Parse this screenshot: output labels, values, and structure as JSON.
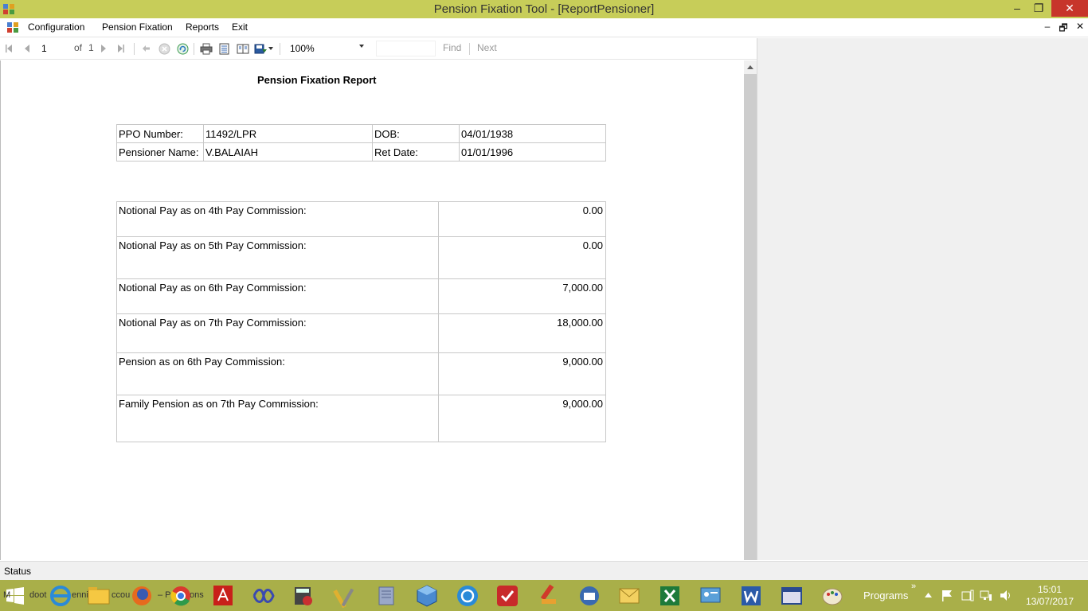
{
  "window": {
    "title": "Pension Fixation Tool - [ReportPensioner]",
    "controls": {
      "minimize": "–",
      "maximize": "❐",
      "close": "✕"
    }
  },
  "menu": {
    "items": [
      "Configuration",
      "Pension Fixation",
      "Reports",
      "Exit"
    ],
    "mdi_controls": {
      "minimize": "–",
      "restore": "🗗",
      "close": "✕"
    }
  },
  "toolbar": {
    "current_page": "1",
    "of_label": "of",
    "total_pages": "1",
    "zoom": "100%",
    "find_label": "Find",
    "next_label": "Next",
    "icons": [
      "first-page-icon",
      "prev-page-icon",
      "next-page-icon",
      "last-page-icon",
      "back-icon",
      "stop-icon",
      "refresh-icon",
      "print-icon",
      "print-layout-icon",
      "page-setup-icon",
      "export-icon"
    ]
  },
  "report": {
    "title": "Pension Fixation Report",
    "info": [
      {
        "label1": "PPO Number:",
        "value1": "11492/LPR",
        "label2": "DOB:",
        "value2": "04/01/1938"
      },
      {
        "label1": "Pensioner Name:",
        "value1": "V.BALAIAH",
        "label2": "Ret Date:",
        "value2": "01/01/1996"
      }
    ],
    "pay_rows": [
      {
        "label": "Notional Pay as on 4th Pay Commission:",
        "value": "0.00"
      },
      {
        "label": "Notional Pay as on 5th Pay Commission:",
        "value": "0.00"
      },
      {
        "label": "Notional Pay as on 6th Pay Commission:",
        "value": "7,000.00"
      },
      {
        "label": "Notional Pay as on 7th Pay Commission:",
        "value": "18,000.00"
      },
      {
        "label": "Pension as on 6th Pay Commission:",
        "value": "9,000.00"
      },
      {
        "label": "Family Pension as on 7th Pay Commission:",
        "value": "9,000.00"
      }
    ]
  },
  "status": {
    "text": "Status"
  },
  "taskbar": {
    "ghost_text_1": "M",
    "ghost_text_2": "doot",
    "ghost_text_3": "enni",
    "ghost_text_4": "ccou",
    "ghost_text_5": "– P",
    "ghost_text_6": "ons",
    "programs_label": "Programs",
    "chevron": "»",
    "time": "15:01",
    "date": "13/07/2017"
  }
}
